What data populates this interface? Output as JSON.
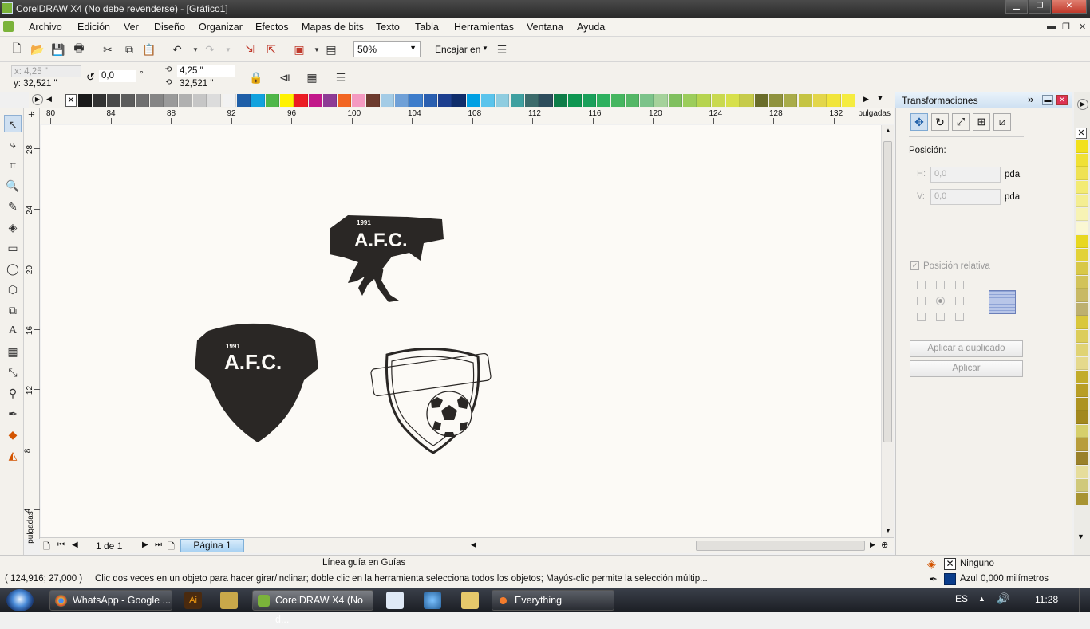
{
  "window": {
    "title": "CorelDRAW X4 (No debe revenderse) - [Gráfico1]"
  },
  "menu": [
    "Archivo",
    "Edición",
    "Ver",
    "Diseño",
    "Organizar",
    "Efectos",
    "Mapas de bits",
    "Texto",
    "Tabla",
    "Herramientas",
    "Ventana",
    "Ayuda"
  ],
  "toolbar": {
    "zoom": "50%",
    "snap": "Encajar en"
  },
  "propbar": {
    "x": "x: 4,25 \"",
    "y": "y: 32,521 \"",
    "angle": "0,0",
    "angle_unit": "°",
    "w": "4,25 \"",
    "h": "32,521 \""
  },
  "ruler_h": {
    "unit": "pulgadas",
    "ticks": [
      "80",
      "84",
      "88",
      "92",
      "96",
      "100",
      "104",
      "108",
      "112",
      "116",
      "120",
      "124",
      "128",
      "132"
    ]
  },
  "ruler_v": {
    "unit": "pulgadas",
    "ticks": [
      "28",
      "24",
      "20",
      "16",
      "12",
      "8",
      "4"
    ]
  },
  "page_nav": {
    "count": "1 de 1",
    "tab": "Página 1"
  },
  "docker": {
    "title": "Transformaciones",
    "position_label": "Posición:",
    "h_label": "H:",
    "h_value": "0,0",
    "v_label": "V:",
    "v_value": "0,0",
    "unit": "pda",
    "relative": "Posición relativa",
    "apply_dup": "Aplicar a duplicado",
    "apply": "Aplicar"
  },
  "logos": {
    "crest_text": "A.F.C.",
    "year": "1991"
  },
  "status": {
    "guide": "Línea guía en Guías",
    "coords": "( 124,916; 27,000 )",
    "hint": "Clic dos veces en un objeto para hacer girar/inclinar; doble clic en la herramienta selecciona todos los objetos; Mayús-clic permite la selección múltip...",
    "fill": "Ninguno",
    "outline": "Azul",
    "outline_width": "0,000 milímetros"
  },
  "taskbar": {
    "tasks": [
      "WhatsApp - Google ...",
      "CorelDRAW X4 (No d...",
      "Everything"
    ],
    "lang": "ES",
    "time": "11:28"
  },
  "colors": {
    "accent": "#1f5fa8",
    "outline_color": "#0a3c8a"
  }
}
